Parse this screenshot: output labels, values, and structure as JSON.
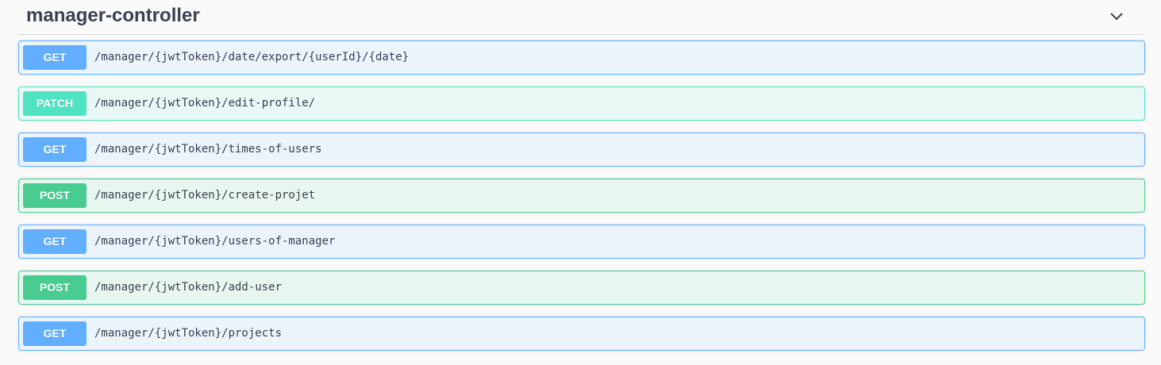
{
  "section": {
    "title": "manager-controller",
    "toggle_icon": "chevron-down-icon"
  },
  "colors": {
    "get": "#61affe",
    "patch": "#50e3c2",
    "post": "#49cc90",
    "title": "#3b4151"
  },
  "operations": [
    {
      "method": "GET",
      "path": "/manager/{jwtToken}/date/export/{userId}/{date}"
    },
    {
      "method": "PATCH",
      "path": "/manager/{jwtToken}/edit-profile/"
    },
    {
      "method": "GET",
      "path": "/manager/{jwtToken}/times-of-users"
    },
    {
      "method": "POST",
      "path": "/manager/{jwtToken}/create-projet"
    },
    {
      "method": "GET",
      "path": "/manager/{jwtToken}/users-of-manager"
    },
    {
      "method": "POST",
      "path": "/manager/{jwtToken}/add-user"
    },
    {
      "method": "GET",
      "path": "/manager/{jwtToken}/projects"
    }
  ]
}
